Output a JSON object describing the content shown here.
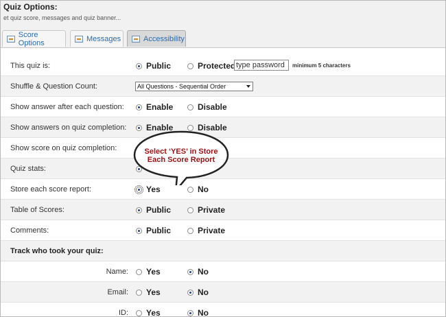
{
  "header": {
    "title": "Quiz Options:",
    "subtitle": "et quiz score, messages and quiz banner...",
    "tabs": [
      {
        "label": "Score Options",
        "icon": "score-options-icon",
        "active": false
      },
      {
        "label": "Messages",
        "icon": "messages-icon",
        "active": false
      },
      {
        "label": "Accessibility",
        "icon": "accessibility-icon",
        "active": true
      }
    ]
  },
  "rows": {
    "quiz_is": {
      "label": "This quiz is:",
      "opt1": "Public",
      "opt2": "Protected",
      "password_value": "type password",
      "hint": "minimum 5 characters"
    },
    "shuffle": {
      "label": "Shuffle & Question Count:",
      "selected": "All Questions - Sequential Order"
    },
    "show_answer_each": {
      "label": "Show answer after each question:",
      "opt1": "Enable",
      "opt2": "Disable"
    },
    "show_answers_completion": {
      "label": "Show answers on quiz completion:",
      "opt1": "Enable",
      "opt2": "Disable"
    },
    "show_score_completion": {
      "label": "Show score on quiz completion:"
    },
    "quiz_stats": {
      "label": "Quiz stats:"
    },
    "store_score": {
      "label": "Store each score report:",
      "opt1": "Yes",
      "opt2": "No"
    },
    "table_scores": {
      "label": "Table of Scores:",
      "opt1": "Public",
      "opt2": "Private"
    },
    "comments": {
      "label": "Comments:",
      "opt1": "Public",
      "opt2": "Private"
    },
    "track": {
      "label": "Track who took your quiz:"
    },
    "name": {
      "label": "Name:",
      "opt1": "Yes",
      "opt2": "No"
    },
    "email": {
      "label": "Email:",
      "opt1": "Yes",
      "opt2": "No"
    },
    "id": {
      "label": "ID:",
      "opt1": "Yes",
      "opt2": "No"
    }
  },
  "callout": {
    "line1": "Select ‘YES’ in Store",
    "line2": "Each Score Report",
    "text_color": "#9c1212"
  }
}
